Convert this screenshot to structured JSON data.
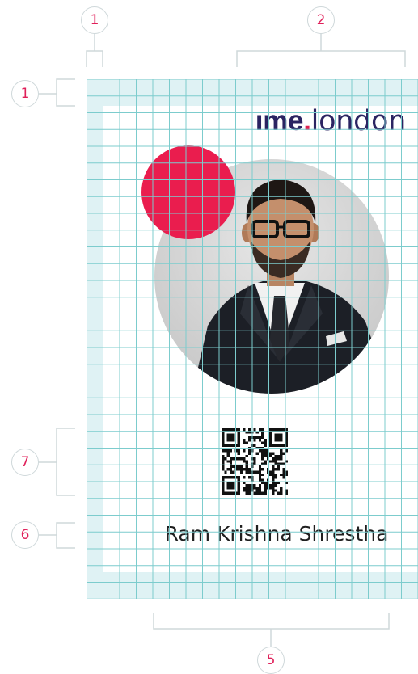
{
  "annotations": {
    "top_left": "1",
    "top_right": "2",
    "left_top": "1",
    "left_qr": "7",
    "left_name": "6",
    "bottom": "5"
  },
  "card": {
    "logo": {
      "brand": "ıme",
      "dot": ".",
      "city": "london"
    },
    "photo": "man-in-suit-with-glasses-portrait",
    "qr": "qr-code",
    "name": "Ram Krishna Shrestha"
  },
  "colors": {
    "grid_line": "#7ccccd",
    "margin_fill": "#dff2f4",
    "accent_pink": "#ea1d4e",
    "brand_navy": "#2b2462",
    "annotation_number": "#e0205a",
    "annotation_line": "#cfd8da"
  }
}
